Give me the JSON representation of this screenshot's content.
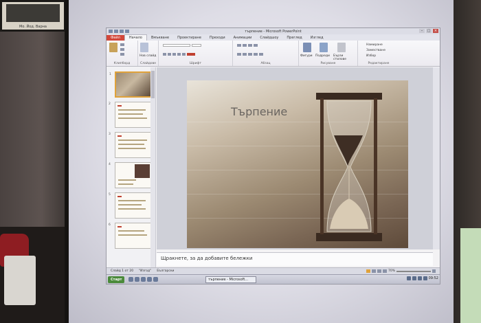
{
  "photo": {
    "wall_frame_caption": "Мо. Йод. Варна"
  },
  "window": {
    "title": "търпение - Microsoft PowerPoint",
    "controls": [
      "–",
      "□",
      "×"
    ]
  },
  "ribbon_tabs": [
    "Файл",
    "Начало",
    "Вмъкване",
    "Проектиране",
    "Преходи",
    "Анимации",
    "Слайдшоу",
    "Преглед",
    "Изглед"
  ],
  "ribbon_groups": {
    "clipboard": "Клипборд",
    "slides": "Слайдове",
    "new_slide": "Нов слайд",
    "font": "Шрифт",
    "paragraph": "Абзац",
    "drawing": "Рисуване",
    "editing": "Редактиране",
    "shapes": "Фигури",
    "arrange": "Подреди",
    "quick_styles": "Бързи стилове",
    "find": "Намиране",
    "replace": "Заместване",
    "select": "Избор"
  },
  "slide": {
    "title": "Търпение"
  },
  "thumbnails": [
    "1",
    "2",
    "3",
    "4",
    "5",
    "6"
  ],
  "notes_placeholder": "Щракнете, за да добавите бележки",
  "status": {
    "slide_of": "Слайд 1 от 20",
    "theme": "\"Изгод\"",
    "language": "Български",
    "zoom": "70%"
  },
  "taskbar": {
    "start": "Старт",
    "task": "търпение - Microsoft...",
    "clock": "09:52"
  }
}
